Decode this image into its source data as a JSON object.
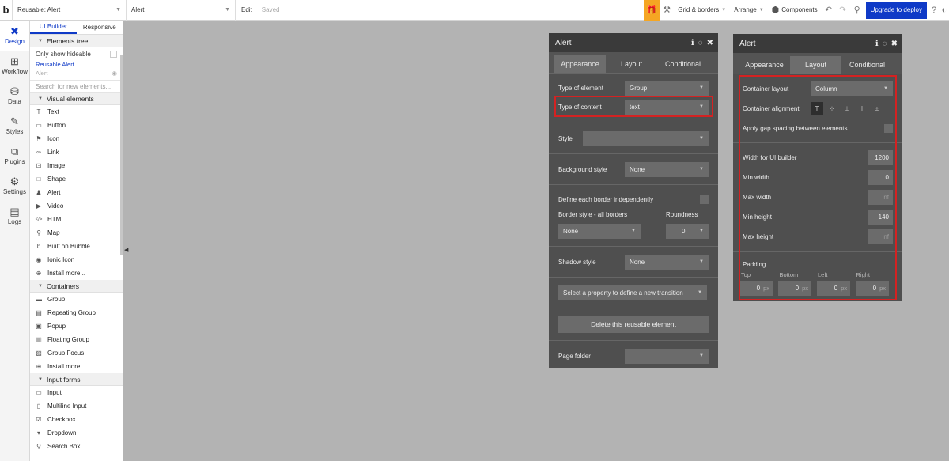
{
  "topbar": {
    "page_select": "Reusable: Alert",
    "element_select": "Alert",
    "edit_label": "Edit",
    "saved_label": "Saved",
    "grid_borders": "Grid & borders",
    "arrange": "Arrange",
    "components": "Components",
    "deploy": "Upgrade to deploy"
  },
  "rail": {
    "items": [
      {
        "label": "Design",
        "icon": "design-icon",
        "glyph": "✖"
      },
      {
        "label": "Workflow",
        "icon": "workflow-icon",
        "glyph": "⊞"
      },
      {
        "label": "Data",
        "icon": "database-icon",
        "glyph": "⛁"
      },
      {
        "label": "Styles",
        "icon": "brush-icon",
        "glyph": "✎"
      },
      {
        "label": "Plugins",
        "icon": "plugin-icon",
        "glyph": "⧉"
      },
      {
        "label": "Settings",
        "icon": "gear-icon",
        "glyph": "⚙"
      },
      {
        "label": "Logs",
        "icon": "document-icon",
        "glyph": "▤"
      }
    ]
  },
  "panel": {
    "tabs": [
      "UI Builder",
      "Responsive"
    ],
    "elements_tree": "Elements tree",
    "only_show_hideable": "Only show hideable",
    "tree_root": "Reusable Alert",
    "tree_child": "Alert",
    "search_placeholder": "Search for new elements...",
    "visual_elements": "Visual elements",
    "visual": [
      {
        "label": "Text",
        "glyph": "T",
        "icon": "text-icon"
      },
      {
        "label": "Button",
        "glyph": "▭",
        "icon": "button-icon"
      },
      {
        "label": "Icon",
        "glyph": "⚑",
        "icon": "flag-icon"
      },
      {
        "label": "Link",
        "glyph": "∞",
        "icon": "link-icon"
      },
      {
        "label": "Image",
        "glyph": "⊡",
        "icon": "image-icon"
      },
      {
        "label": "Shape",
        "glyph": "□",
        "icon": "shape-icon"
      },
      {
        "label": "Alert",
        "glyph": "♟",
        "icon": "bell-icon"
      },
      {
        "label": "Video",
        "glyph": "▶",
        "icon": "video-icon"
      },
      {
        "label": "HTML",
        "glyph": "</>",
        "icon": "html-icon"
      },
      {
        "label": "Map",
        "glyph": "⚲",
        "icon": "map-pin-icon"
      },
      {
        "label": "Built on Bubble",
        "glyph": "b",
        "icon": "bubble-icon"
      },
      {
        "label": "Ionic Icon",
        "glyph": "◉",
        "icon": "ionic-icon"
      },
      {
        "label": "Install more...",
        "glyph": "⊕",
        "icon": "plus-circle-icon"
      }
    ],
    "containers": "Containers",
    "container_items": [
      {
        "label": "Group",
        "glyph": "▬",
        "icon": "folder-icon"
      },
      {
        "label": "Repeating Group",
        "glyph": "▤",
        "icon": "repeating-group-icon"
      },
      {
        "label": "Popup",
        "glyph": "▣",
        "icon": "popup-icon"
      },
      {
        "label": "Floating Group",
        "glyph": "▥",
        "icon": "floating-group-icon"
      },
      {
        "label": "Group Focus",
        "glyph": "▧",
        "icon": "group-focus-icon"
      },
      {
        "label": "Install more...",
        "glyph": "⊕",
        "icon": "plus-circle-icon"
      }
    ],
    "input_forms": "Input forms",
    "input_items": [
      {
        "label": "Input",
        "glyph": "▭",
        "icon": "input-icon"
      },
      {
        "label": "Multiline Input",
        "glyph": "▯",
        "icon": "multiline-icon"
      },
      {
        "label": "Checkbox",
        "glyph": "☑",
        "icon": "checkbox-icon"
      },
      {
        "label": "Dropdown",
        "glyph": "▾",
        "icon": "dropdown-icon"
      },
      {
        "label": "Search Box",
        "glyph": "⚲",
        "icon": "search-icon"
      }
    ]
  },
  "appearance_window": {
    "title": "Alert",
    "tabs": [
      "Appearance",
      "Layout",
      "Conditional"
    ],
    "type_of_element_label": "Type of element",
    "type_of_element_value": "Group",
    "type_of_content_label": "Type of content",
    "type_of_content_value": "text",
    "style_label": "Style",
    "style_value": "",
    "background_style_label": "Background style",
    "background_style_value": "None",
    "define_border_label": "Define each border independently",
    "border_style_label": "Border style - all borders",
    "roundness_label": "Roundness",
    "border_style_value": "None",
    "roundness_value": "0",
    "shadow_style_label": "Shadow style",
    "shadow_style_value": "None",
    "transition_placeholder": "Select a property to define a new transition",
    "delete_button": "Delete this reusable element",
    "page_folder_label": "Page folder",
    "page_folder_value": ""
  },
  "layout_window": {
    "title": "Alert",
    "tabs": [
      "Appearance",
      "Layout",
      "Conditional"
    ],
    "container_layout_label": "Container layout",
    "container_layout_value": "Column",
    "container_alignment_label": "Container alignment",
    "gap_spacing_label": "Apply gap spacing between elements",
    "width_builder_label": "Width for UI builder",
    "width_builder_value": "1200",
    "min_width_label": "Min width",
    "min_width_value": "0",
    "max_width_label": "Max width",
    "max_width_value": "inf",
    "min_height_label": "Min height",
    "min_height_value": "140",
    "max_height_label": "Max height",
    "max_height_value": "inf",
    "padding_label": "Padding",
    "padding": [
      {
        "label": "Top",
        "value": "0"
      },
      {
        "label": "Bottom",
        "value": "0"
      },
      {
        "label": "Left",
        "value": "0"
      },
      {
        "label": "Right",
        "value": "0"
      }
    ],
    "unit": "px"
  },
  "colors": {
    "accent": "#0f3ac7",
    "highlight": "#d42222",
    "gift": "#f5a623"
  }
}
